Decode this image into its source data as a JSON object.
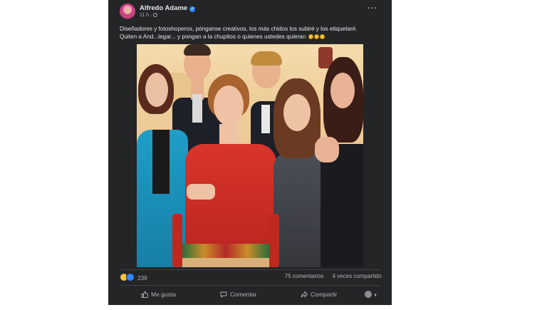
{
  "post": {
    "author": "Alfredo Adame",
    "time": "11 h",
    "visibility_icon": "globe-icon",
    "caption_line1": "Diseñadores y fotoshoperos, pónganse creativos, los más chidos los subiré y los etiquetaré.",
    "caption_line2": "Quiten a And...legar... y pongan a la chupitos o quienes ustedes quieran",
    "photo_alt": "group photo of six people in a TV studio"
  },
  "stats": {
    "reactions_count": "239",
    "comments": "75 comentarios",
    "shares": "4 veces compartido"
  },
  "actions": {
    "like": "Me gusta",
    "comment": "Comentar",
    "share": "Compartir"
  },
  "colors": {
    "card_bg": "#242526",
    "text_primary": "#e4e6eb",
    "text_secondary": "#b0b3b8",
    "like_blue": "#2d88ff",
    "haha_yellow": "#f7c33b"
  }
}
